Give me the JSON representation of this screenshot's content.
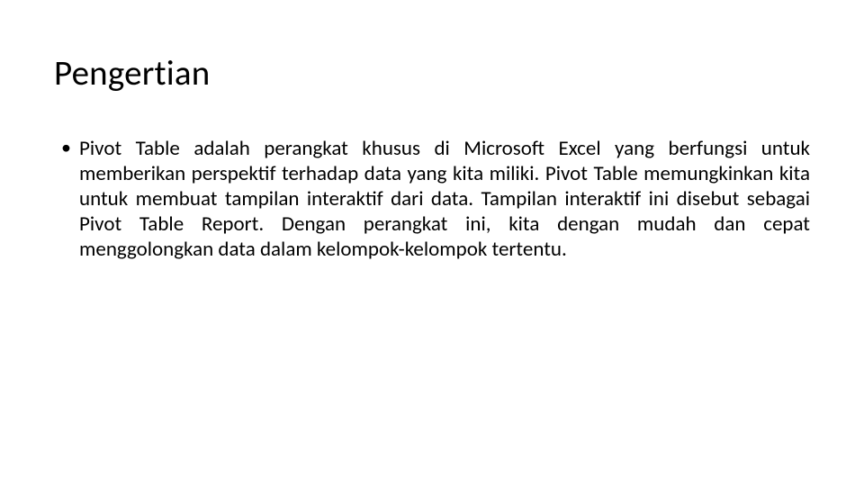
{
  "slide": {
    "title": "Pengertian",
    "bullets": [
      "Pivot Table adalah perangkat khusus di Microsoft Excel yang berfungsi untuk memberikan perspektif terhadap data yang kita miliki. Pivot Table memungkinkan kita untuk membuat tampilan interaktif dari data. Tampilan interaktif ini disebut sebagai Pivot Table Report. Dengan perangkat ini, kita dengan mudah dan cepat menggolongkan data dalam kelompok-kelompok tertentu."
    ]
  }
}
